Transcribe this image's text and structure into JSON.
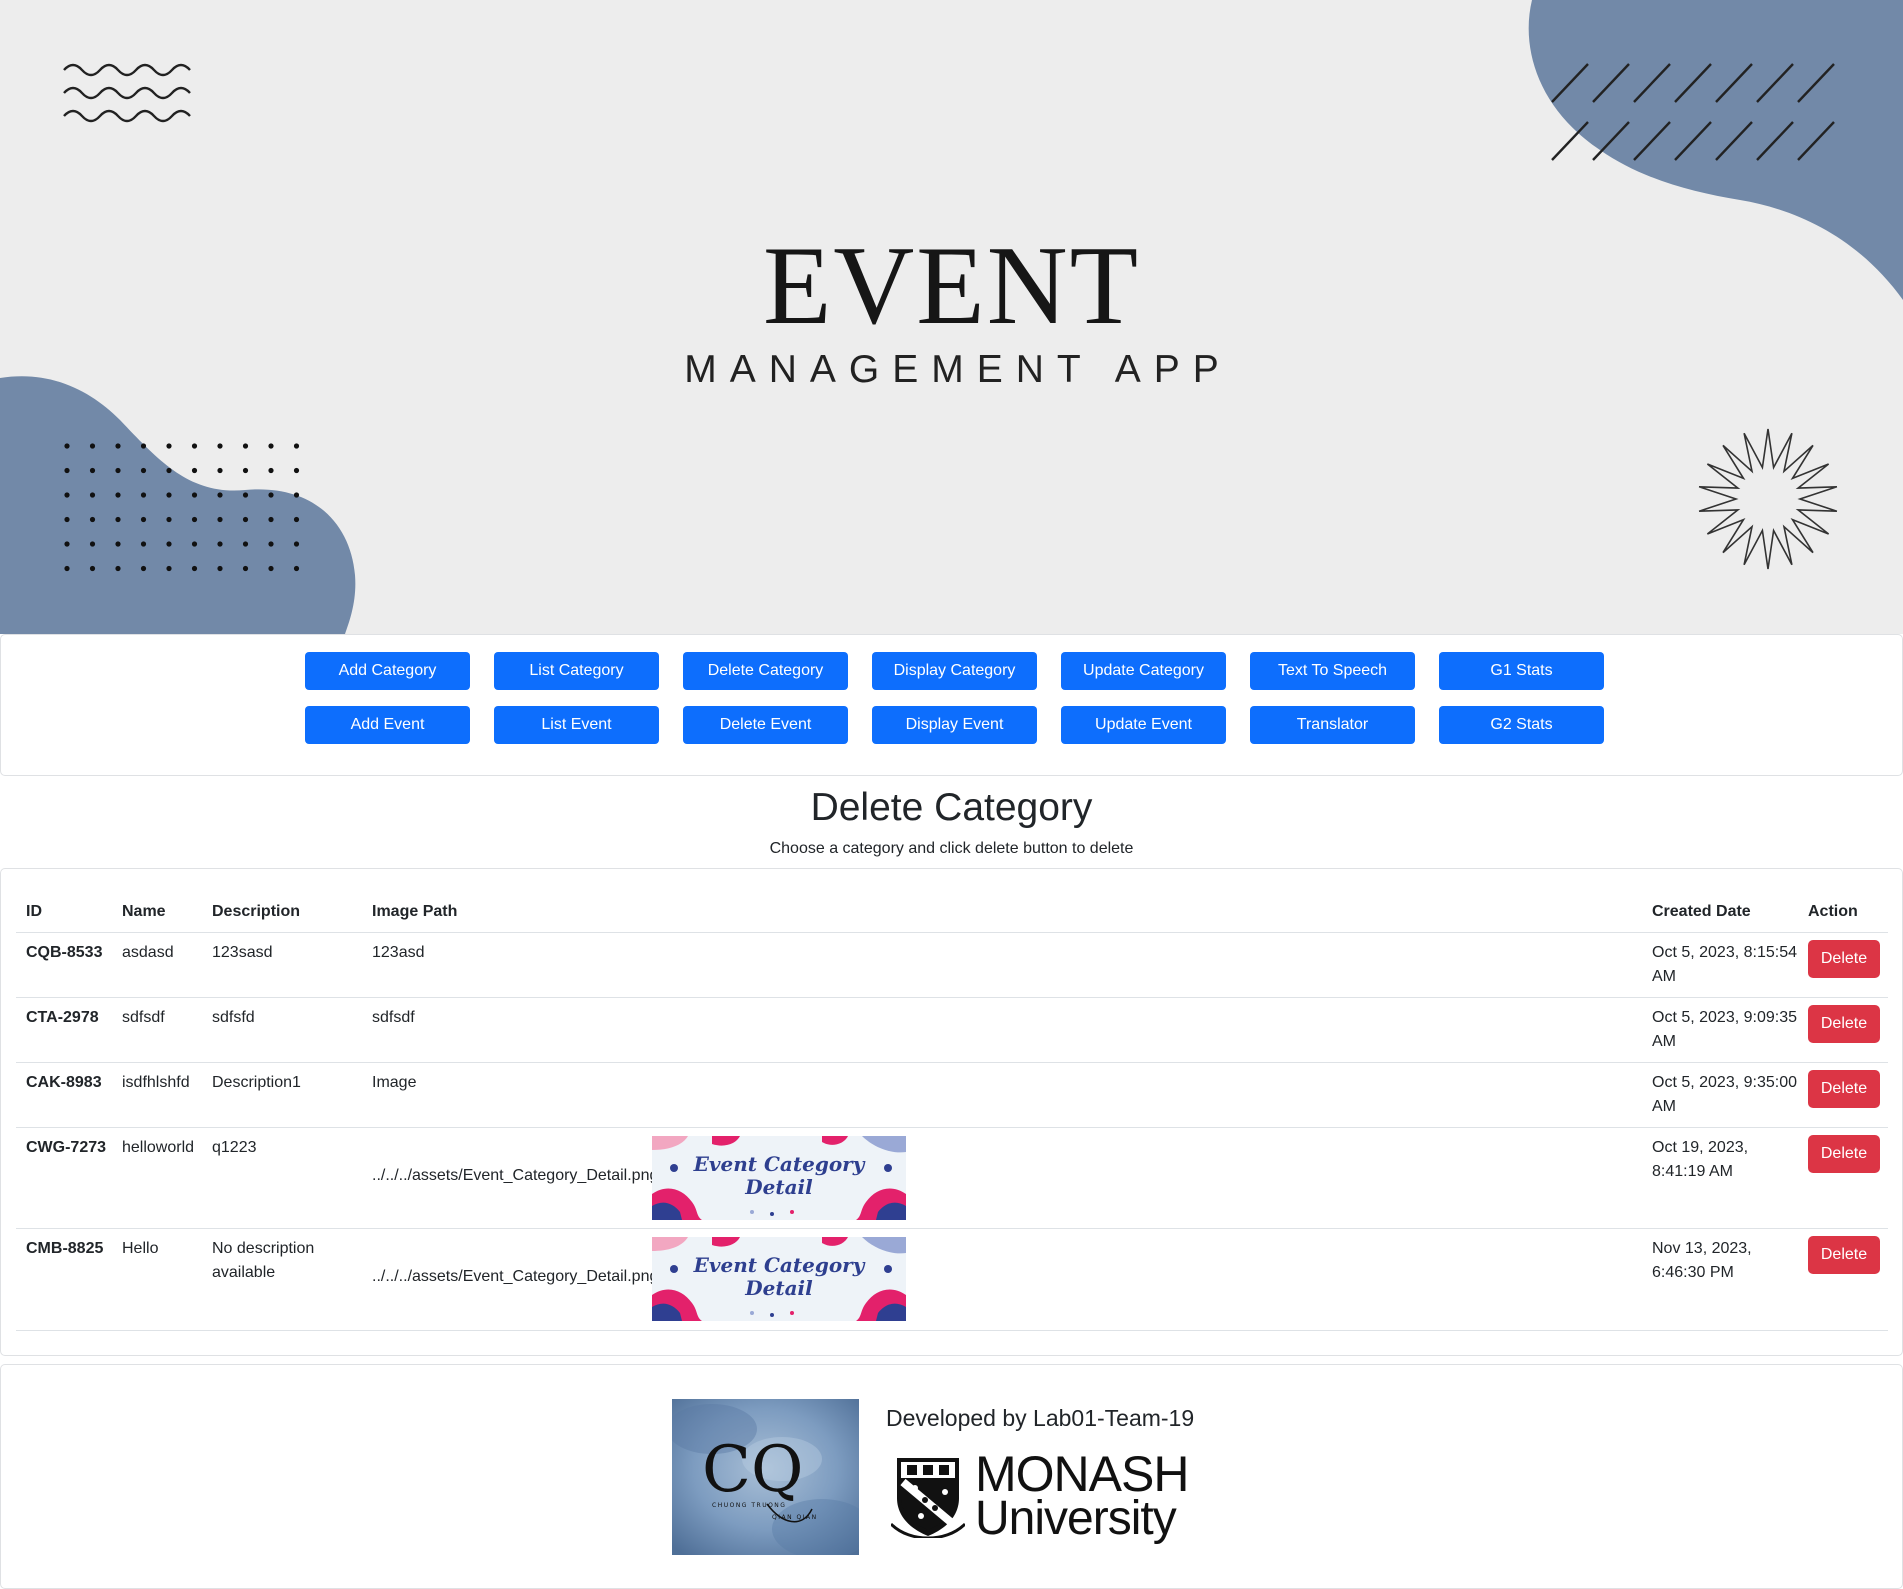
{
  "hero": {
    "title": "EVENT",
    "subtitle": "MANAGEMENT APP"
  },
  "nav": {
    "row1": [
      "Add Category",
      "List Category",
      "Delete Category",
      "Display Category",
      "Update Category",
      "Text To Speech",
      "G1 Stats"
    ],
    "row2": [
      "Add Event",
      "List Event",
      "Delete Event",
      "Display Event",
      "Update Event",
      "Translator",
      "G2 Stats"
    ]
  },
  "page": {
    "title": "Delete Category",
    "subtitle": "Choose a category and click delete button to delete"
  },
  "table": {
    "headers": {
      "id": "ID",
      "name": "Name",
      "description": "Description",
      "image_path": "Image Path",
      "created_date": "Created Date",
      "action": "Action"
    },
    "rows": [
      {
        "id": "CQB-8533",
        "name": "asdasd",
        "description": "123sasd",
        "image_path": "123asd",
        "has_image": false,
        "date_line1": "Oct 5, 2023, 8:15:54",
        "date_line2": "AM",
        "action": "Delete"
      },
      {
        "id": "CTA-2978",
        "name": "sdfsdf",
        "description": "sdfsfd",
        "image_path": "sdfsdf",
        "has_image": false,
        "date_line1": "Oct 5, 2023, 9:09:35",
        "date_line2": "AM",
        "action": "Delete"
      },
      {
        "id": "CAK-8983",
        "name": "isdfhlshfd",
        "description": "Description1",
        "image_path": "Image",
        "has_image": false,
        "date_line1": "Oct 5, 2023, 9:35:00",
        "date_line2": "AM",
        "action": "Delete"
      },
      {
        "id": "CWG-7273",
        "name": "helloworld",
        "description": "q1223",
        "image_path": "../../../assets/Event_Category_Detail.png",
        "has_image": true,
        "date_line1": "Oct 19, 2023,",
        "date_line2": "8:41:19 AM",
        "action": "Delete"
      },
      {
        "id": "CMB-8825",
        "name": "Hello",
        "description": "No description available",
        "image_path": "../../../assets/Event_Category_Detail.png",
        "has_image": true,
        "date_line1": "Nov 13, 2023,",
        "date_line2": "6:46:30 PM",
        "action": "Delete"
      }
    ],
    "image_caption_line1": "Event Category",
    "image_caption_line2": "Detail"
  },
  "footer": {
    "developed_by": "Developed by Lab01-Team-19",
    "cq_logo_letters": "CQ",
    "cq_logo_small1": "CHUONG TRUONG",
    "cq_logo_small2": "QIAN QIAN",
    "university_word1": "MONASH",
    "university_word2": "University"
  },
  "colors": {
    "primary": "#0d6efd",
    "danger": "#dc3545",
    "hero_bg": "#ededed",
    "hero_blob": "#7289a8"
  },
  "icons": [
    "wave-lines-icon",
    "diagonal-lines-icon",
    "dot-grid-icon",
    "starburst-icon",
    "monash-crest-icon"
  ]
}
